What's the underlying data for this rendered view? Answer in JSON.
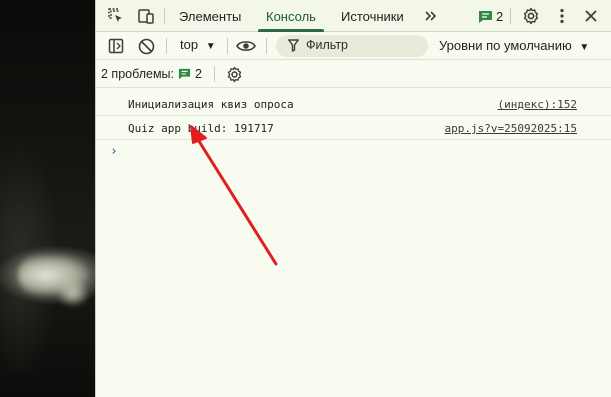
{
  "devtools": {
    "tabs": [
      {
        "label": "Элементы"
      },
      {
        "label": "Консоль"
      },
      {
        "label": "Источники"
      }
    ],
    "issues_count": "2"
  },
  "console_toolbar": {
    "context": "top",
    "filter_placeholder": "Фильтр",
    "levels": "Уровни по умолчанию"
  },
  "issues_bar": {
    "label": "2 проблемы:",
    "count": "2"
  },
  "messages": [
    {
      "text": "Инициализация квиз опроса",
      "source": "(индекс):152"
    },
    {
      "text": "Quiz app build: 191717",
      "source": "app.js?v=25092025:15"
    }
  ],
  "colors": {
    "background": "#f8fbf0",
    "active_tab": "#2f6b3f",
    "annotation_arrow": "#e02020"
  }
}
